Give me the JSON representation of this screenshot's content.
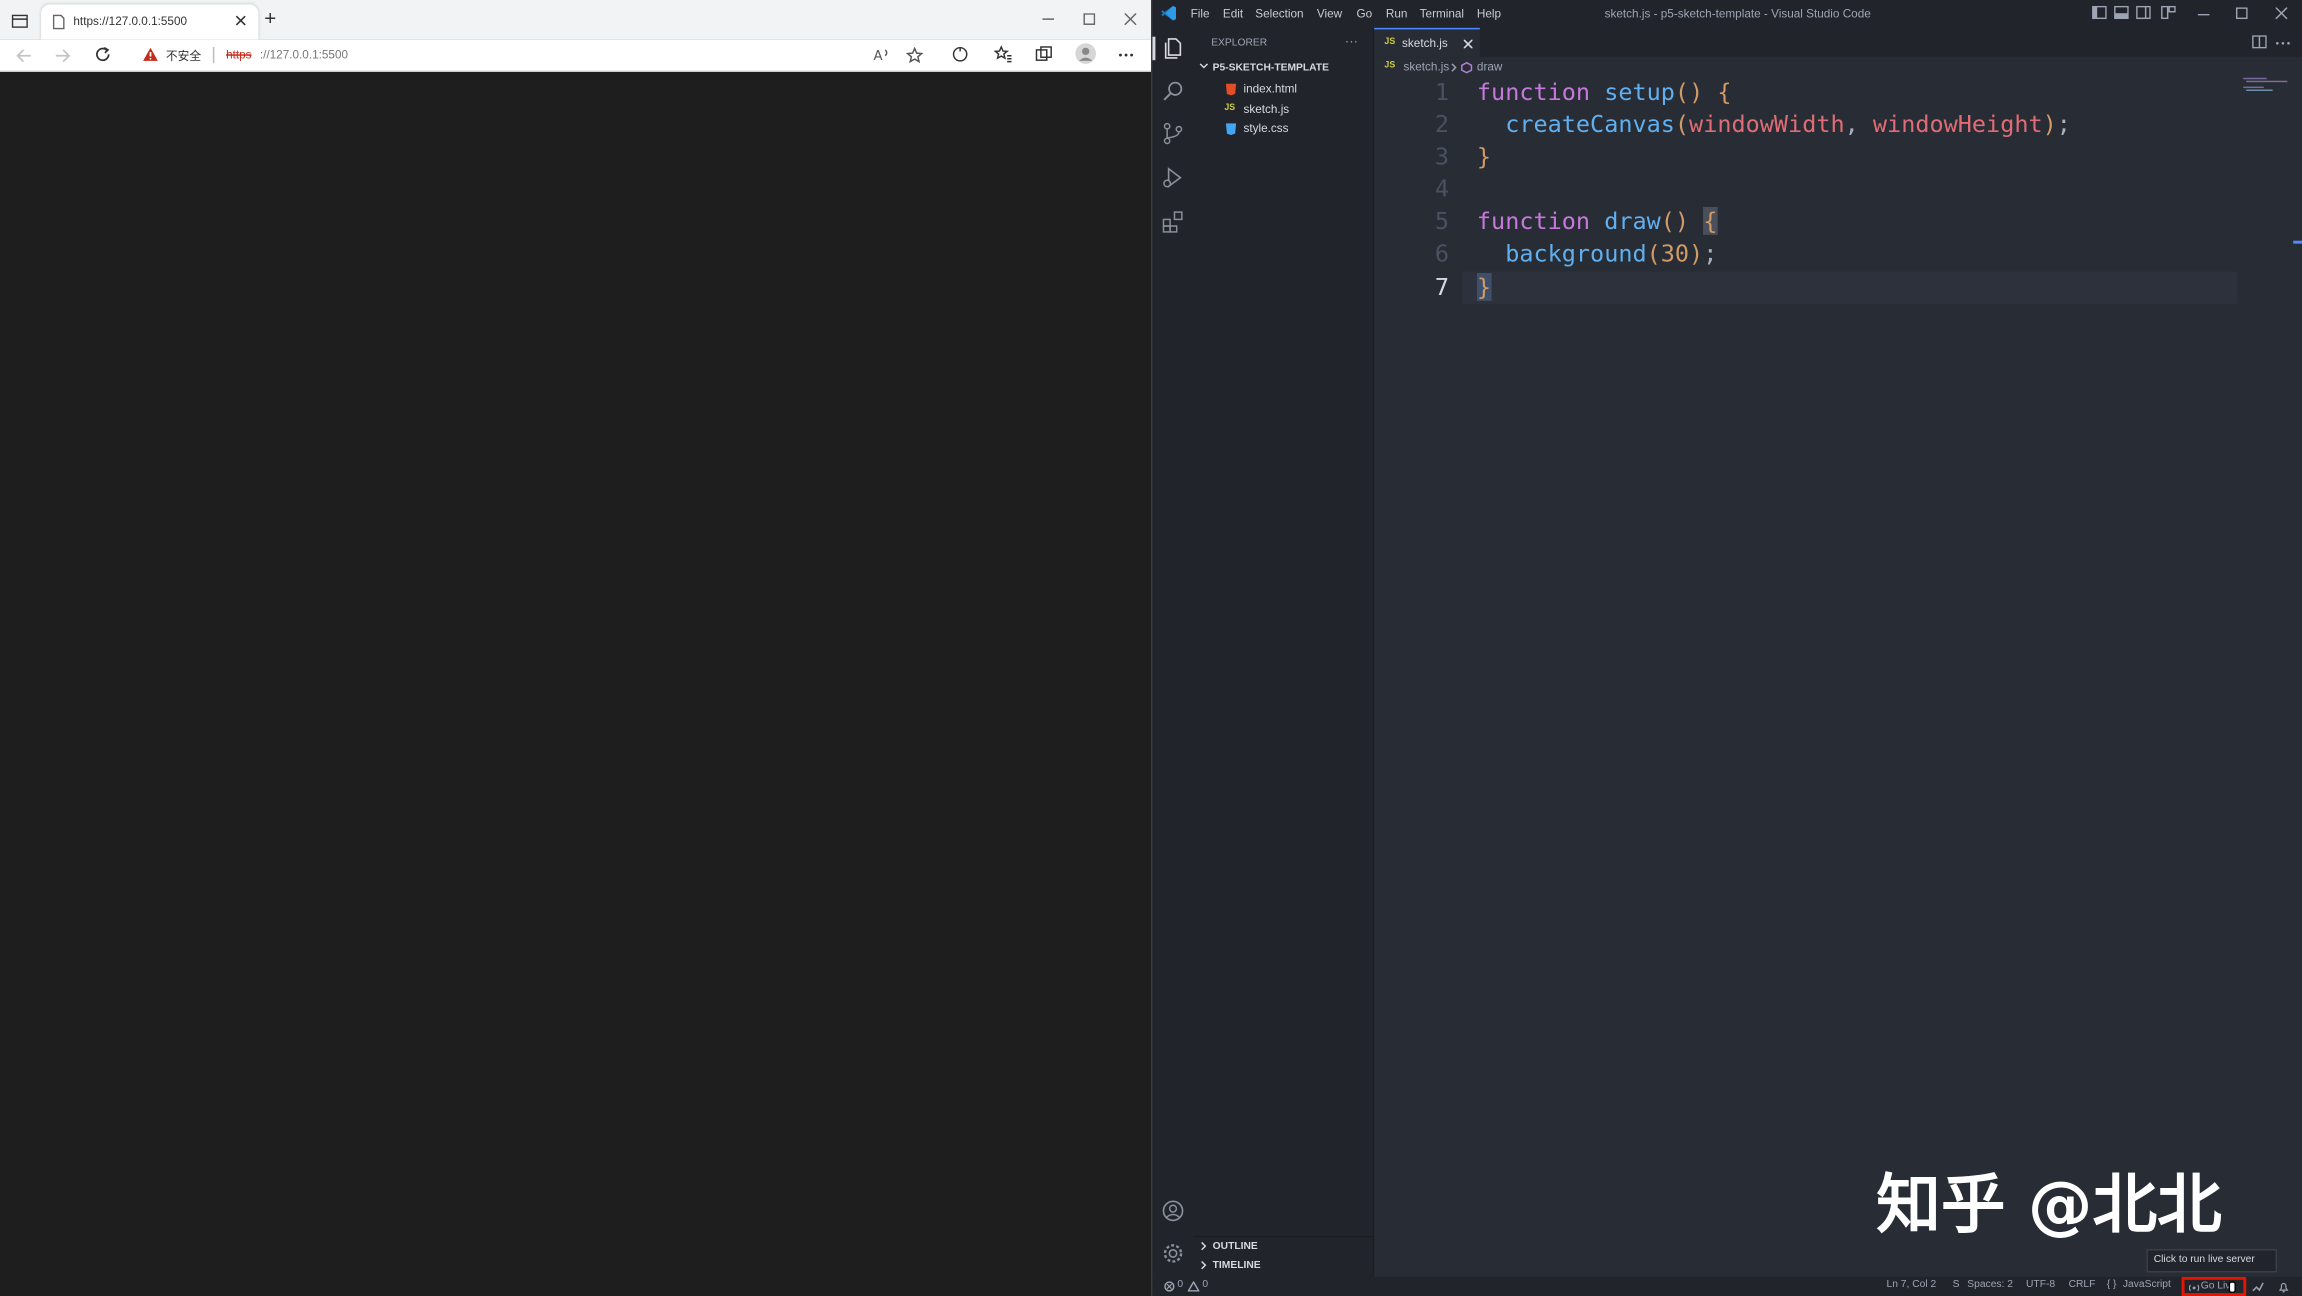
{
  "browser": {
    "tab_title": "https://127.0.0.1:5500",
    "new_tab": "+",
    "security_label": "不安全",
    "url_scheme": "https",
    "url_rest": "://127.0.0.1:5500"
  },
  "vscode": {
    "menu": [
      "File",
      "Edit",
      "Selection",
      "View",
      "Go",
      "Run",
      "Terminal",
      "Help"
    ],
    "window_title": "sketch.js - p5-sketch-template - Visual Studio Code",
    "explorer": {
      "title": "EXPLORER",
      "more": "···",
      "folder": "P5-SKETCH-TEMPLATE",
      "files": [
        {
          "name": "index.html",
          "icon": "html-file-icon",
          "color": "#e44d26"
        },
        {
          "name": "sketch.js",
          "icon": "js-file-icon",
          "color": "#cbcb41"
        },
        {
          "name": "style.css",
          "icon": "css-file-icon",
          "color": "#42a5f5"
        }
      ],
      "outline": "OUTLINE",
      "timeline": "TIMELINE"
    },
    "editor": {
      "tab_label": "sketch.js",
      "tab_badge": "JS",
      "breadcrumb_file": "sketch.js",
      "breadcrumb_symbol": "draw",
      "line_numbers": [
        "1",
        "2",
        "3",
        "4",
        "5",
        "6",
        "7"
      ],
      "code": {
        "l1_kw": "function",
        "l1_fn": "setup",
        "l1_rest": "() {",
        "l2_fn": "createCanvas",
        "l2_arg1": "windowWidth",
        "l2_arg2": "windowHeight",
        "l3": "}",
        "l5_kw": "function",
        "l5_fn": "draw",
        "l5_rest": "() ",
        "l5_brace": "{",
        "l6_fn": "background",
        "l6_num": "30",
        "l7": "}"
      }
    },
    "status": {
      "errors": "0",
      "warnings": "0",
      "position": "Ln 7, Col 2",
      "spaces": "Spaces: 2",
      "encoding": "UTF-8",
      "eol": "CRLF",
      "language": "JavaScript",
      "go_live": "Go Live",
      "tooltip": "Click to run live server"
    }
  },
  "watermark": "知乎 @北北",
  "colors": {
    "editor_bg": "#282c34",
    "sidebar_bg": "#21252b",
    "highlight": "#e51400",
    "keyword": "#c678dd",
    "function": "#61afef",
    "variable": "#e06c75",
    "number": "#d19a66"
  }
}
